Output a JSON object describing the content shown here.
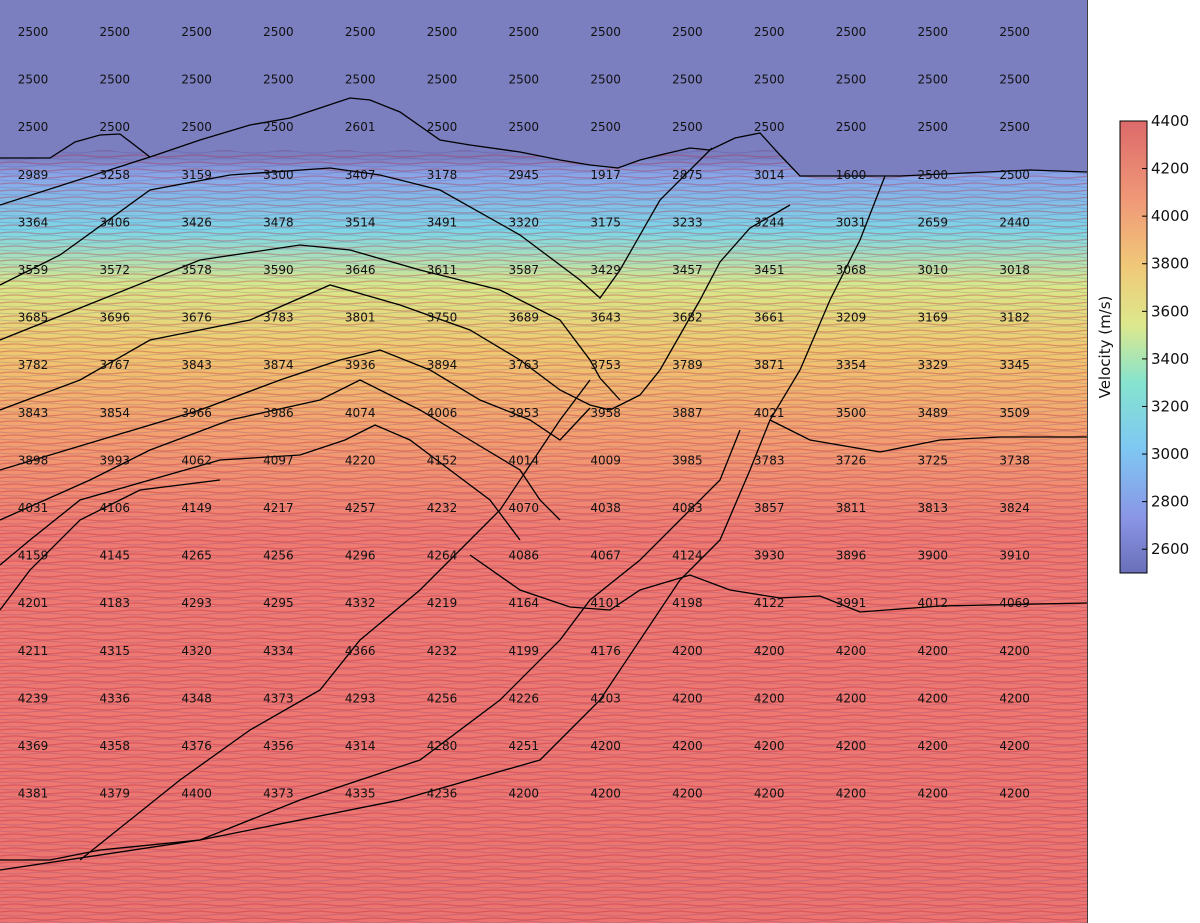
{
  "chart_data": {
    "type": "heatmap",
    "title": "",
    "colorbar": {
      "label": "Velocity (m/s)",
      "min": 2500,
      "max": 4400,
      "colormap": "jet",
      "ticks": [
        "4400",
        "4200",
        "4000",
        "3800",
        "3600",
        "3400",
        "3200",
        "3000",
        "2800",
        "2600"
      ]
    },
    "grid": false,
    "velocity_labels": {
      "rows": [
        [
          "2500",
          "2500",
          "2500",
          "2500",
          "2500",
          "2500",
          "2500",
          "2500",
          "2500",
          "2500",
          "2500",
          "2500",
          "2500"
        ],
        [
          "2500",
          "2500",
          "2500",
          "2500",
          "2500",
          "2500",
          "2500",
          "2500",
          "2500",
          "2500",
          "2500",
          "2500",
          "2500"
        ],
        [
          "2500",
          "2500",
          "2500",
          "2500",
          "2601",
          "2500",
          "2500",
          "2500",
          "2500",
          "2500",
          "2500",
          "2500",
          "2500"
        ],
        [
          "2989",
          "3258",
          "3159",
          "3300",
          "3407",
          "3178",
          "2945",
          "1917",
          "2875",
          "3014",
          "1600",
          "2500",
          "2500"
        ],
        [
          "3364",
          "3406",
          "3426",
          "3478",
          "3514",
          "3491",
          "3320",
          "3175",
          "3233",
          "3244",
          "3031",
          "2659",
          "2440"
        ],
        [
          "3559",
          "3572",
          "3578",
          "3590",
          "3646",
          "3611",
          "3587",
          "3429",
          "3457",
          "3451",
          "3068",
          "3010",
          "3018"
        ],
        [
          "3685",
          "3696",
          "3676",
          "3783",
          "3801",
          "3750",
          "3689",
          "3643",
          "3682",
          "3661",
          "3209",
          "3169",
          "3182"
        ],
        [
          "3782",
          "3767",
          "3843",
          "3874",
          "3936",
          "3894",
          "3763",
          "3753",
          "3789",
          "3871",
          "3354",
          "3329",
          "3345"
        ],
        [
          "3843",
          "3854",
          "3966",
          "3986",
          "4074",
          "4006",
          "3953",
          "3958",
          "3887",
          "4021",
          "3500",
          "3489",
          "3509"
        ],
        [
          "3898",
          "3993",
          "4062",
          "4097",
          "4220",
          "4152",
          "4014",
          "4009",
          "3985",
          "3783",
          "3726",
          "3725",
          "3738"
        ],
        [
          "4031",
          "4106",
          "4149",
          "4217",
          "4257",
          "4232",
          "4070",
          "4038",
          "4083",
          "3857",
          "3811",
          "3813",
          "3824"
        ],
        [
          "4159",
          "4145",
          "4265",
          "4256",
          "4296",
          "4264",
          "4086",
          "4067",
          "4124",
          "3930",
          "3896",
          "3900",
          "3910"
        ],
        [
          "4201",
          "4183",
          "4293",
          "4295",
          "4332",
          "4219",
          "4164",
          "4101",
          "4198",
          "4122",
          "3991",
          "4012",
          "4069"
        ],
        [
          "4211",
          "4315",
          "4320",
          "4334",
          "4366",
          "4232",
          "4199",
          "4176",
          "4200",
          "4200",
          "4200",
          "4200",
          "4200"
        ],
        [
          "4239",
          "4336",
          "4348",
          "4373",
          "4293",
          "4256",
          "4226",
          "4203",
          "4200",
          "4200",
          "4200",
          "4200",
          "4200"
        ],
        [
          "4369",
          "4358",
          "4376",
          "4356",
          "4314",
          "4280",
          "4251",
          "4200",
          "4200",
          "4200",
          "4200",
          "4200",
          "4200"
        ],
        [
          "4381",
          "4379",
          "4400",
          "4373",
          "4335",
          "4236",
          "4200",
          "4200",
          "4200",
          "4200",
          "4200",
          "4200",
          "4200"
        ]
      ]
    }
  }
}
